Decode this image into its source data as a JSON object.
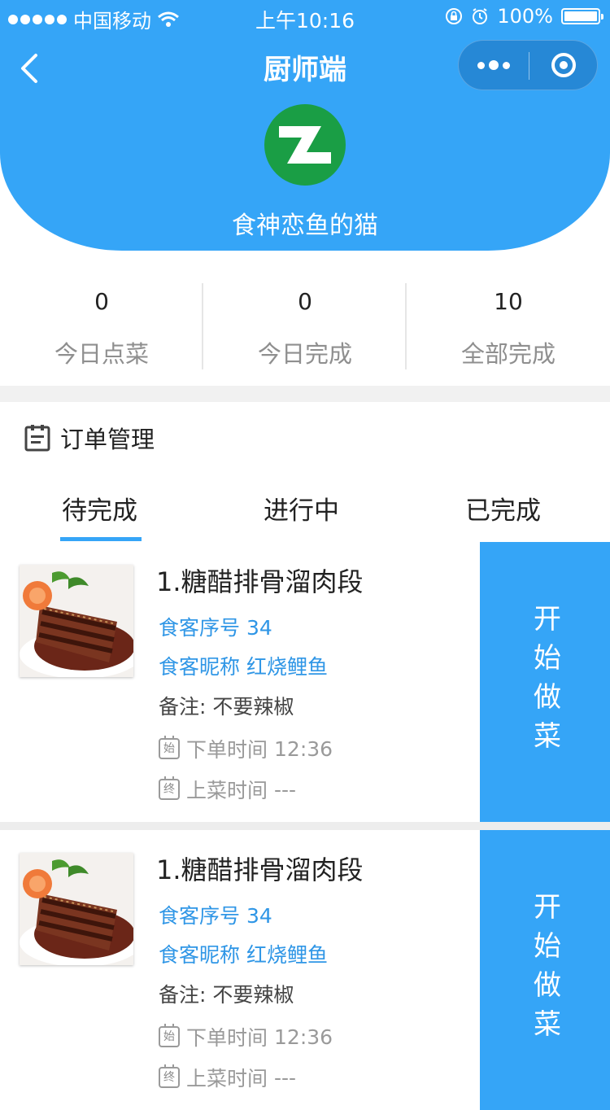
{
  "status_bar": {
    "carrier": "中国移动",
    "time": "上午10:16",
    "battery": "100%"
  },
  "nav": {
    "title": "厨师端"
  },
  "profile": {
    "store_name": "食神恋鱼的猫"
  },
  "stats": [
    {
      "value": "0",
      "label": "今日点菜"
    },
    {
      "value": "0",
      "label": "今日完成"
    },
    {
      "value": "10",
      "label": "全部完成"
    }
  ],
  "section": {
    "title": "订单管理"
  },
  "tabs": [
    {
      "label": "待完成",
      "active": true
    },
    {
      "label": "进行中",
      "active": false
    },
    {
      "label": "已完成",
      "active": false
    }
  ],
  "orders": [
    {
      "dish": "1.糖醋排骨溜肉段",
      "guest_no_label": "食客序号",
      "guest_no": "34",
      "nickname_label": "食客昵称",
      "nickname": "红烧鲤鱼",
      "note_label": "备注:",
      "note": "不要辣椒",
      "order_badge": "始",
      "order_time_label": "下单时间",
      "order_time": "12:36",
      "serve_badge": "终",
      "serve_time_label": "上菜时间",
      "serve_time": "---",
      "action": "开始做菜"
    },
    {
      "dish": "1.糖醋排骨溜肉段",
      "guest_no_label": "食客序号",
      "guest_no": "34",
      "nickname_label": "食客昵称",
      "nickname": "红烧鲤鱼",
      "note_label": "备注:",
      "note": "不要辣椒",
      "order_badge": "始",
      "order_time_label": "下单时间",
      "order_time": "12:36",
      "serve_badge": "终",
      "serve_time_label": "上菜时间",
      "serve_time": "---",
      "action": "开始做菜"
    }
  ],
  "colors": {
    "brand": "#35a5f7",
    "link": "#2f96e6",
    "logo_green": "#1a9e45"
  }
}
